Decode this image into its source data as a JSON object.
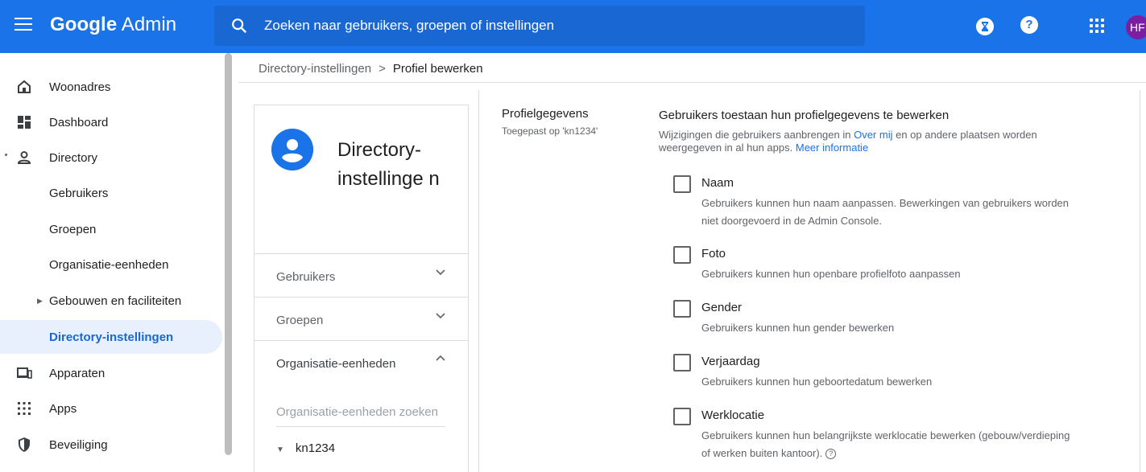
{
  "topbar": {
    "brand_google": "Google",
    "brand_admin": "Admin",
    "search_placeholder": "Zoeken naar gebruikers, groepen of instellingen",
    "help_glyph": "?",
    "avatar_initials": "HF",
    "color": "#1a73e8"
  },
  "sidebar": {
    "items": [
      {
        "label": "Woonadres",
        "icon": "home-icon"
      },
      {
        "label": "Dashboard",
        "icon": "dashboard-icon"
      },
      {
        "label": "Directory",
        "icon": "person-icon"
      },
      {
        "label": "Gebruikers"
      },
      {
        "label": "Groepen"
      },
      {
        "label": "Organisatie-eenheden"
      },
      {
        "label": "Gebouwen en faciliteiten"
      },
      {
        "label": "Directory-instellingen",
        "active": true
      },
      {
        "label": "Apparaten",
        "icon": "devices-icon"
      },
      {
        "label": "Apps",
        "icon": "apps-icon"
      },
      {
        "label": "Beveiliging",
        "icon": "shield-icon"
      }
    ]
  },
  "breadcrumb": {
    "parent": "Directory-instellingen",
    "separator": ">",
    "current": "Profiel bewerken"
  },
  "card": {
    "title": "Directory-instellinge n",
    "sections": [
      {
        "label": "Gebruikers",
        "expanded": false
      },
      {
        "label": "Groepen",
        "expanded": false
      },
      {
        "label": "Organisatie-eenheden",
        "expanded": true
      }
    ],
    "ou_search_placeholder": "Organisatie-eenheden zoeken",
    "ou_root": "kn1234"
  },
  "section": {
    "title": "Profielgegevens",
    "applied": "Toegepast op 'kn1234'"
  },
  "setting": {
    "title": "Gebruikers toestaan hun profielgegevens te bewerken",
    "desc_part1": "Wijzigingen die gebruikers aanbrengen in ",
    "desc_link1": "Over mij",
    "desc_part2": " en op andere plaatsen worden weergegeven in al hun apps. ",
    "desc_link2": "Meer informatie",
    "options": [
      {
        "title": "Naam",
        "desc": "Gebruikers kunnen hun naam aanpassen. Bewerkingen van gebruikers worden niet doorgevoerd in de Admin Console.",
        "checked": false
      },
      {
        "title": "Foto",
        "desc": "Gebruikers kunnen hun openbare profielfoto aanpassen",
        "checked": false
      },
      {
        "title": "Gender",
        "desc": "Gebruikers kunnen hun gender bewerken",
        "checked": false
      },
      {
        "title": "Verjaardag",
        "desc": "Gebruikers kunnen hun geboortedatum bewerken",
        "checked": false
      },
      {
        "title": "Werklocatie",
        "desc": "Gebruikers kunnen hun belangrijkste werklocatie bewerken (gebouw/verdieping of werken buiten kantoor).",
        "checked": false
      }
    ]
  }
}
